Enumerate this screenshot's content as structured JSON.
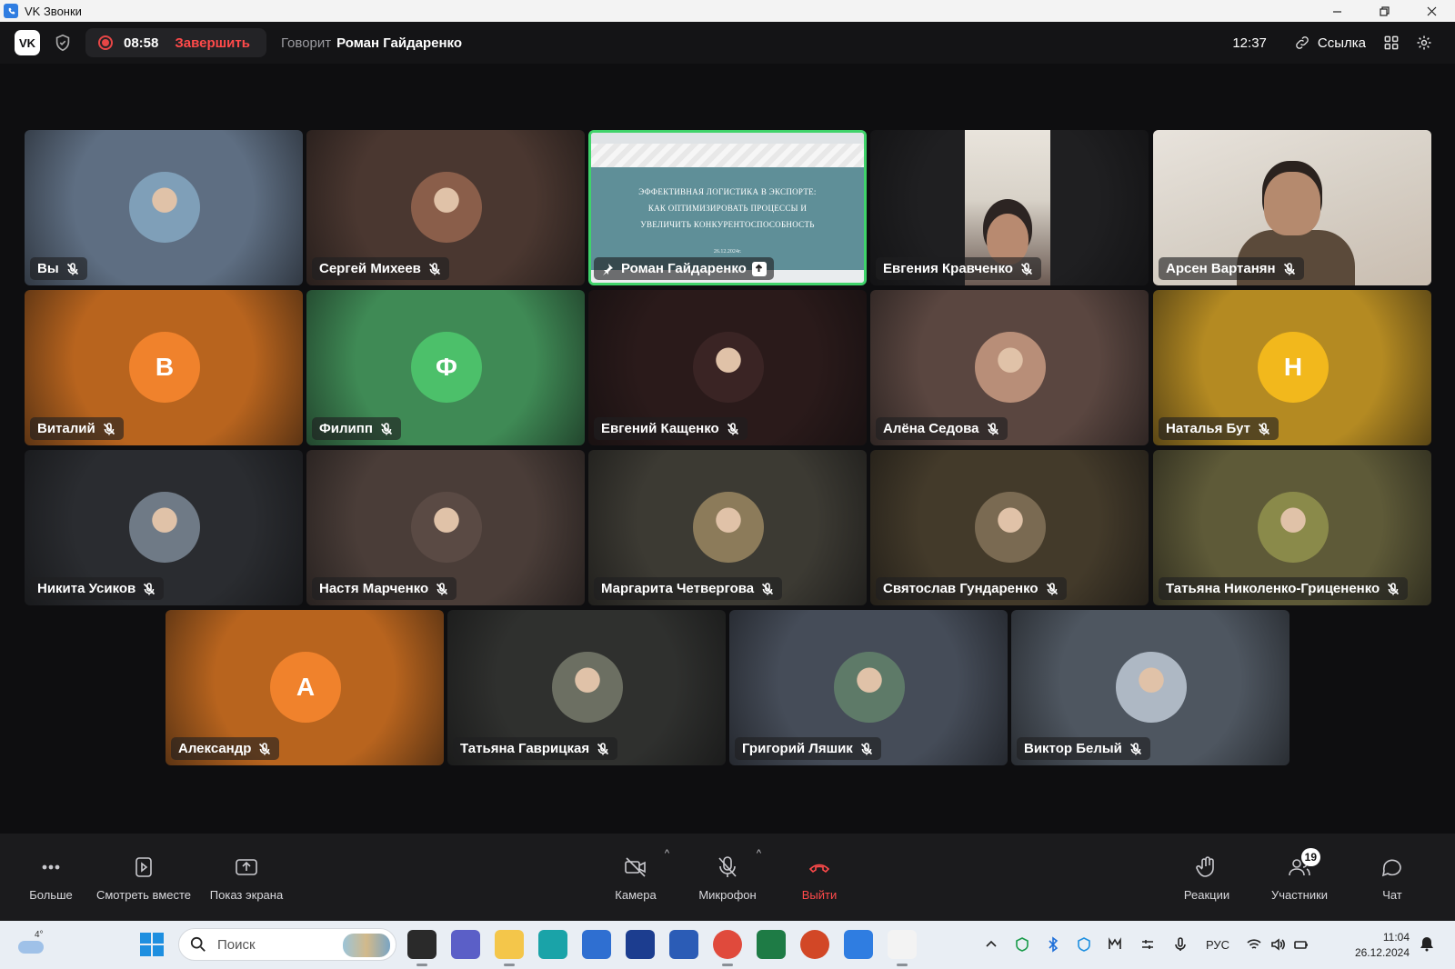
{
  "window": {
    "title": "VK Звонки"
  },
  "callbar": {
    "logo_text": "VK",
    "rec_time": "08:58",
    "end_label": "Завершить",
    "speaking_label": "Говорит",
    "speaking_name": "Роман Гайдаренко",
    "clock": "12:37",
    "link_label": "Ссылка"
  },
  "presentation": {
    "line1": "ЭФФЕКТИВНАЯ ЛОГИСТИКА В ЭКСПОРТЕ:",
    "line2": "КАК ОПТИМИЗИРОВАТЬ ПРОЦЕССЫ И",
    "line3": "УВЕЛИЧИТЬ КОНКУРЕНТОСПОСОБНОСТЬ",
    "date": "26.12.2024г."
  },
  "participants": [
    {
      "name": "Вы",
      "initial": "",
      "bg": "#5e6e82",
      "avatar": "#7f9fb8"
    },
    {
      "name": "Сергей Михеев",
      "initial": "",
      "bg": "#4a3730",
      "avatar": "#8a5e4a"
    },
    {
      "name": "Роман Гайдаренко",
      "initial": "",
      "bg": "#5f8f98",
      "avatar": ""
    },
    {
      "name": "Евгения Кравченко",
      "initial": "",
      "bg": "#1f1f21",
      "avatar": ""
    },
    {
      "name": "Арсен Вартанян",
      "initial": "",
      "bg": "#cfc8bf",
      "avatar": ""
    },
    {
      "name": "Виталий",
      "initial": "В",
      "bg": "#b8641e",
      "avatar": "#f0822c"
    },
    {
      "name": "Филипп",
      "initial": "Ф",
      "bg": "#3f8a55",
      "avatar": "#4cc06a"
    },
    {
      "name": "Евгений Кащенко",
      "initial": "",
      "bg": "#2a1a1a",
      "avatar": "#3a2424"
    },
    {
      "name": "Алёна Седова",
      "initial": "",
      "bg": "#5a4640",
      "avatar": "#b88e78"
    },
    {
      "name": "Наталья Бут",
      "initial": "Н",
      "bg": "#b48a22",
      "avatar": "#f2b81c"
    },
    {
      "name": "Никита Усиков",
      "initial": "",
      "bg": "#2a2c30",
      "avatar": "#6f7a86"
    },
    {
      "name": "Настя Марченко",
      "initial": "",
      "bg": "#4a3d38",
      "avatar": "#5a4a44"
    },
    {
      "name": "Маргарита Четвергова",
      "initial": "",
      "bg": "#3c3a33",
      "avatar": "#8c7b5a"
    },
    {
      "name": "Святослав Гундаренко",
      "initial": "",
      "bg": "#433a2a",
      "avatar": "#7a6a52"
    },
    {
      "name": "Татьяна Николенко-Грицененко",
      "initial": "",
      "bg": "#5e5a38",
      "avatar": "#8a8a4a"
    },
    {
      "name": "Александр",
      "initial": "А",
      "bg": "#b8641e",
      "avatar": "#f0822c"
    },
    {
      "name": "Татьяна Гаврицкая",
      "initial": "",
      "bg": "#2f302e",
      "avatar": "#6c6f62"
    },
    {
      "name": "Григорий Ляшик",
      "initial": "",
      "bg": "#454c58",
      "avatar": "#5e7a68"
    },
    {
      "name": "Виктор Белый",
      "initial": "",
      "bg": "#4e5660",
      "avatar": "#aeb8c4"
    }
  ],
  "toolbar": {
    "more": "Больше",
    "watch": "Смотреть вместе",
    "share": "Показ экрана",
    "camera": "Камера",
    "mic": "Микрофон",
    "leave": "Выйти",
    "reactions": "Реакции",
    "participants": "Участники",
    "participants_count": "19",
    "chat": "Чат"
  },
  "taskbar": {
    "weather_temp": "4°",
    "search_placeholder": "Поиск",
    "lang": "РУС",
    "time": "11:04",
    "date": "26.12.2024"
  }
}
